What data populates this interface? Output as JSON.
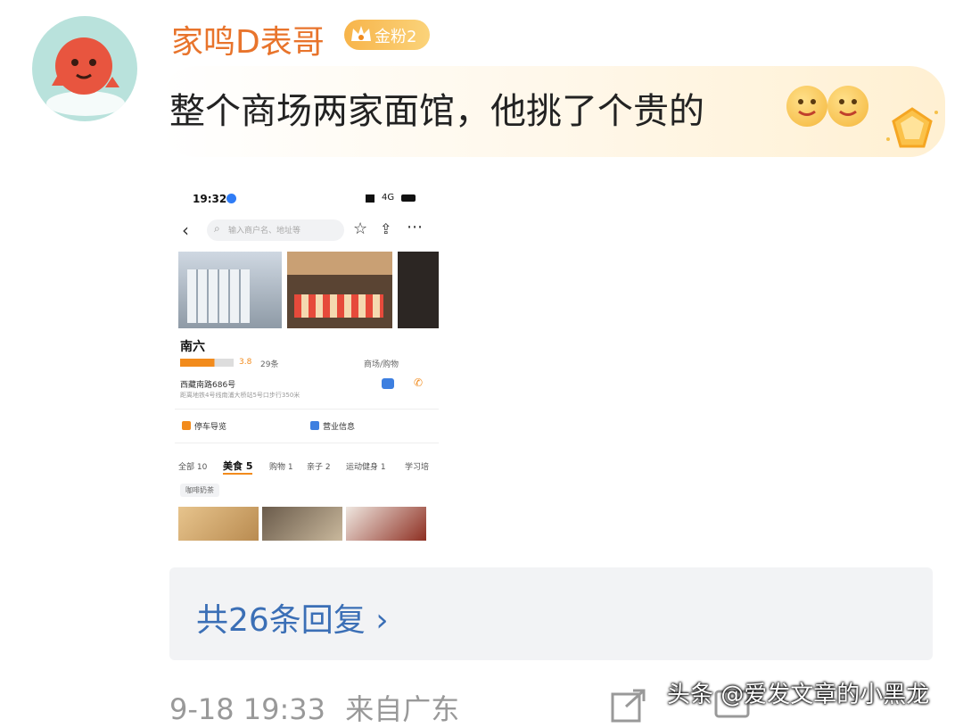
{
  "post": {
    "username": "家鸣D表哥",
    "badge": "金粉2",
    "comment": "整个商场两家面馆，他挑了个贵的"
  },
  "screenshot": {
    "time": "19:32",
    "network": "4G",
    "search_placeholder": "输入商户名、地址等",
    "venue_name": "南六",
    "rating": "3.8",
    "review_count": "29条",
    "category": "商场/购物",
    "address": "西藏南路686号",
    "address_sub": "距离地铁4号线南浦大桥站5号口步行350米",
    "service_left": "停车导览",
    "service_right": "营业信息",
    "tabs": [
      "全部 10",
      "美食 5",
      "购物 1",
      "亲子 2",
      "运动健身 1",
      "学习培"
    ],
    "chip": "咖啡奶茶"
  },
  "replies": {
    "label": "共26条回复 ›"
  },
  "meta": {
    "date": "9-18 19:33",
    "location": "来自广东"
  },
  "watermark": "头条 @爱发文章的小黑龙",
  "colors": {
    "username": "#e8742c",
    "link": "#3b6fb6",
    "meta": "#999999"
  }
}
